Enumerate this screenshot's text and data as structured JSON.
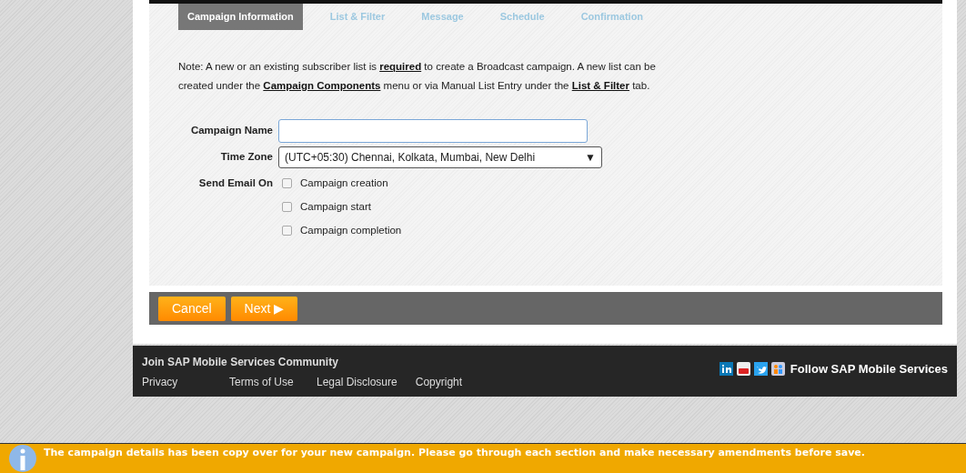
{
  "tabs": [
    {
      "label": "Campaign Information",
      "selected": true
    },
    {
      "label": "List & Filter",
      "selected": false
    },
    {
      "label": "Message",
      "selected": false
    },
    {
      "label": "Schedule",
      "selected": false
    },
    {
      "label": "Confirmation",
      "selected": false
    }
  ],
  "note": [
    [
      {
        "kind": "text",
        "text": "Note: A new or an existing subscriber list is "
      },
      {
        "kind": "link",
        "text": "required"
      },
      {
        "kind": "text",
        "text": " to create a Broadcast campaign. A new list can be"
      }
    ],
    [
      {
        "kind": "text",
        "text": "created under the "
      },
      {
        "kind": "link",
        "text": "Campaign Components"
      },
      {
        "kind": "text",
        "text": " menu or via Manual List Entry under the "
      },
      {
        "kind": "link",
        "text": "List & Filter"
      },
      {
        "kind": "text",
        "text": " tab."
      }
    ]
  ],
  "campaign_name": {
    "label": "Campaign Name"
  },
  "time_zone": {
    "label": "Time Zone",
    "value": "(UTC+05:30) Chennai, Kolkata, Mumbai, New Delhi",
    "caret": "▼"
  },
  "send_email_on": {
    "label": "Send Email On",
    "options": [
      {
        "label": "Campaign creation",
        "checked": false
      },
      {
        "label": "Campaign start",
        "checked": false
      },
      {
        "label": "Campaign completion",
        "checked": false
      }
    ]
  },
  "buttons": [
    {
      "label": "Cancel"
    },
    {
      "label": "Next ▶"
    }
  ],
  "footer": {
    "heading": "Join SAP Mobile Services Community",
    "links": [
      "Privacy",
      "Terms of Use",
      "Legal Disclosure",
      "Copyright"
    ],
    "follow": "Follow SAP Mobile Services"
  },
  "notification": "The campaign details has been copy over for your new campaign. Please go through each section and make necessary amendments before save."
}
